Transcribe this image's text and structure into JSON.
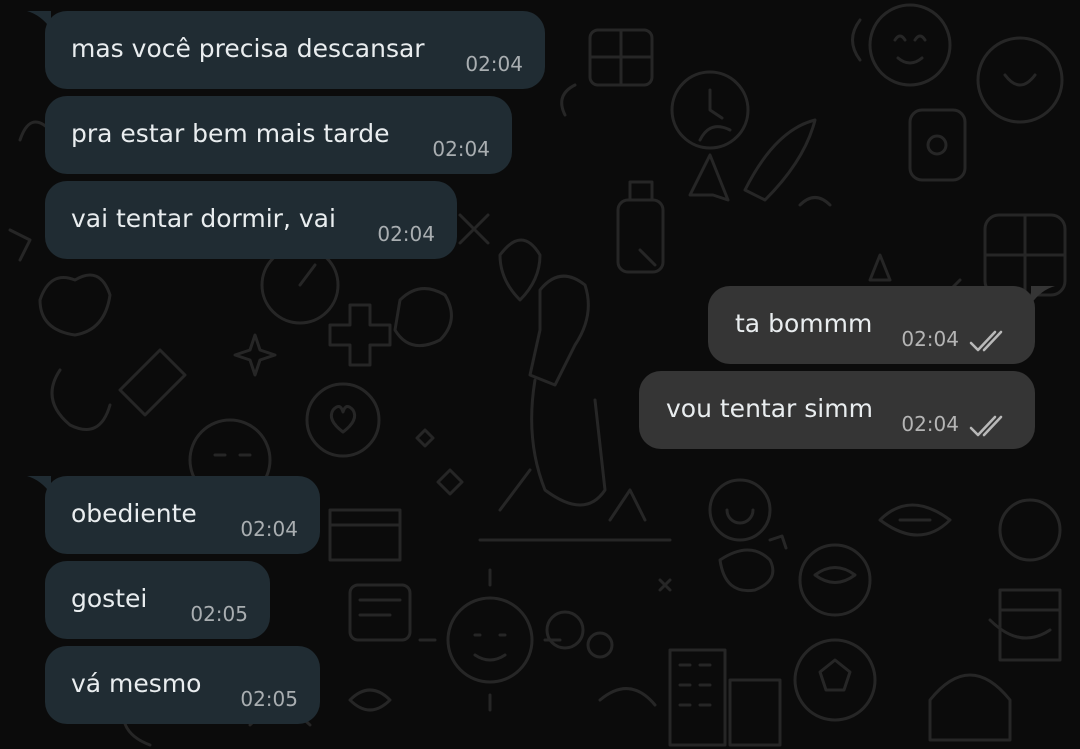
{
  "theme": {
    "background": "#0b0b0b",
    "incoming_bubble": "#202c33",
    "outgoing_bubble": "#353535",
    "text": "#e9edef",
    "timestamp": "#a9aeb1",
    "read_ticks": "#b8b8b8"
  },
  "messages": [
    {
      "direction": "incoming",
      "text": "mas você precisa descansar",
      "time": "02:04"
    },
    {
      "direction": "incoming",
      "text": "pra estar bem mais tarde",
      "time": "02:04"
    },
    {
      "direction": "incoming",
      "text": "vai tentar dormir, vai",
      "time": "02:04"
    },
    {
      "direction": "outgoing",
      "text": "ta bommm",
      "time": "02:04",
      "status_icon": "double-check-icon"
    },
    {
      "direction": "outgoing",
      "text": "vou tentar simm",
      "time": "02:04",
      "status_icon": "double-check-icon"
    },
    {
      "direction": "incoming",
      "text": "obediente",
      "time": "02:04"
    },
    {
      "direction": "incoming",
      "text": "gostei",
      "time": "02:05"
    },
    {
      "direction": "incoming",
      "text": "vá mesmo",
      "time": "02:05"
    }
  ]
}
